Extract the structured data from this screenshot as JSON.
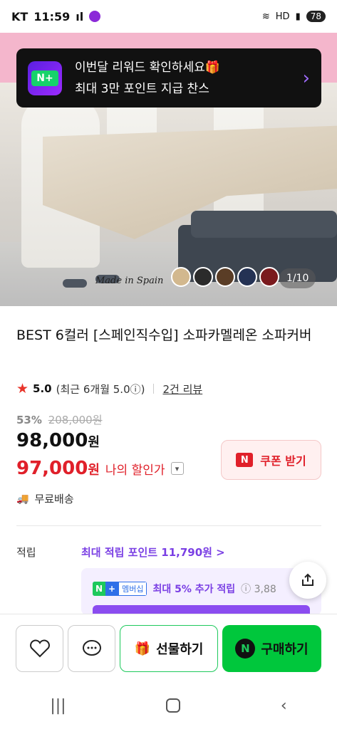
{
  "status_bar": {
    "carrier": "KT",
    "time": "11:59",
    "battery": "78"
  },
  "notification": {
    "icon_label": "N+",
    "line1": "이번달 리워드 확인하세요🎁",
    "line2": "최대 3만 포인트 지급 찬스"
  },
  "hero": {
    "made_in": "Made in Spain",
    "counter": "1/10",
    "swatch_colors": [
      "#d2b88e",
      "#2b2b2b",
      "#5a3d26",
      "#243254",
      "#7a1a1e",
      "#5b5a4c"
    ]
  },
  "product": {
    "title": "BEST 6컬러 [스페인직수입] 소파카멜레온 소파커버",
    "rating_score": "5.0",
    "rating_recent": "(최근 6개월 5.0ⓘ)",
    "review_link": "2건 리뷰",
    "discount_pct": "53%",
    "original_price": "208,000원",
    "price": "98,000",
    "price_unit": "원",
    "my_price": "97,000",
    "my_price_unit": "원",
    "my_price_label": "나의 할인가",
    "coupon_button": "쿠폰 받기",
    "shipping": "무료배송"
  },
  "points": {
    "label": "적립",
    "value": "최대 적립 포인트 11,790원 >",
    "membership_badge": "멤버십",
    "membership_text": "최대 5% 추가 적립",
    "membership_info": "ⓘ 3,88"
  },
  "actions": {
    "gift_label": "선물하기",
    "buy_label": "구매하기"
  }
}
